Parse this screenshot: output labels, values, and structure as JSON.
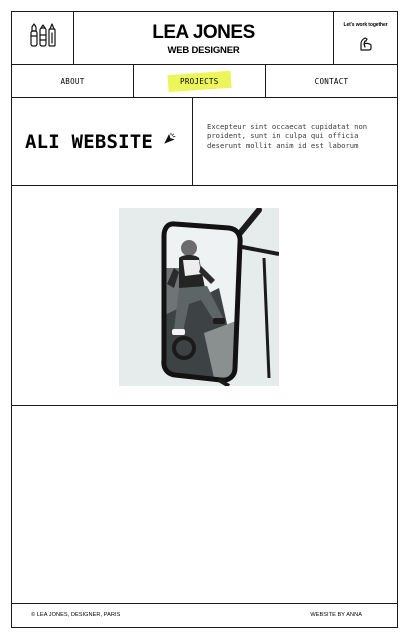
{
  "header": {
    "logo_icon": "design-tools-icon",
    "name": "LEA JONES",
    "role": "WEB DESIGNER",
    "cta_text": "Let's work together",
    "cta_icon": "flexed-arm-icon"
  },
  "nav": {
    "about": "ABOUT",
    "projects": "PROJECTS",
    "contact": "CONTACT",
    "highlight_color": "#ecf55a"
  },
  "hero": {
    "title": "ALI WEBSITE",
    "title_icon": "cursor-sparkle-icon",
    "description": "Excepteur sint occaecat cupidatat non proident, sunt in culpa qui officia deserunt mollit anim id est laborum"
  },
  "project_image": {
    "subject": "person-in-side-mirror-photo"
  },
  "footer": {
    "left_text": "© LEA JONES, DESIGNER, PARIS",
    "right_text": "WEBSITE BY ANNA"
  }
}
